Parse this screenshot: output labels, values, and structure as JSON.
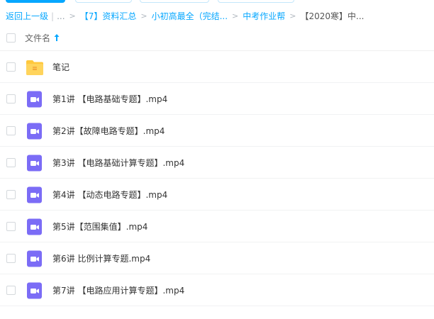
{
  "breadcrumb": {
    "back": "返回上一级",
    "pipe": "|",
    "ellipsis": "...",
    "sep": ">",
    "items": [
      "【7】资料汇总",
      "小初高最全（完结...",
      "中考作业帮",
      "【2020寒】中..."
    ]
  },
  "header": {
    "column_name": "文件名"
  },
  "files": [
    {
      "name": "笔记",
      "type": "folder",
      "icon": "folder-icon"
    },
    {
      "name": "第1讲 【电路基础专题】.mp4",
      "type": "video",
      "icon": "video-file-icon"
    },
    {
      "name": "第2讲【故障电路专题】.mp4",
      "type": "video",
      "icon": "video-file-icon"
    },
    {
      "name": "第3讲 【电路基础计算专题】.mp4",
      "type": "video",
      "icon": "video-file-icon"
    },
    {
      "name": "第4讲 【动态电路专题】.mp4",
      "type": "video",
      "icon": "video-file-icon"
    },
    {
      "name": "第5讲【范围集值】.mp4",
      "type": "video",
      "icon": "video-file-icon"
    },
    {
      "name": "第6讲 比例计算专题.mp4",
      "type": "video",
      "icon": "video-file-icon"
    },
    {
      "name": "第7讲 【电路应用计算专题】.mp4",
      "type": "video",
      "icon": "video-file-icon"
    }
  ],
  "colors": {
    "accent": "#06a7ff",
    "folder": "#ffc83d",
    "video": "#7b6cf6"
  }
}
